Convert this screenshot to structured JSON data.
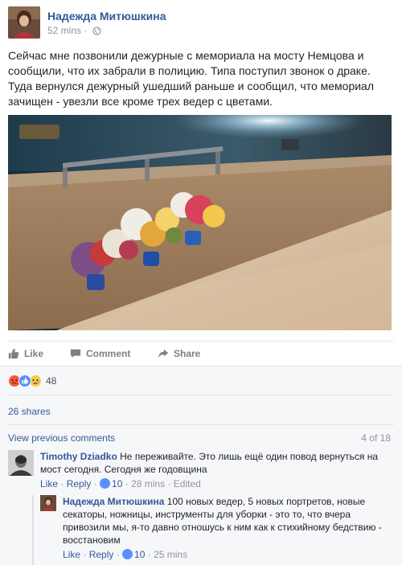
{
  "post": {
    "author": "Надежда Митюшкина",
    "time": "52 mins",
    "separator": "·",
    "privacy_icon": "globe-icon",
    "text": "Сейчас мне позвонили дежурные с мемориала на мосту Немцова и сообщили, что их забрали в полицию. Типа поступил звонок о драке. Туда вернулся дежурный ушедший раньше и сообщил, что мемориал зачищен - увезли все кроме трех ведер с цветами."
  },
  "actions": {
    "like": "Like",
    "comment": "Comment",
    "share": "Share"
  },
  "reactions": {
    "icons": [
      "angry-icon",
      "like-icon",
      "sad-icon"
    ],
    "count": "48"
  },
  "shares": "26 shares",
  "comments": {
    "view_previous": "View previous comments",
    "count_of": "4 of 18",
    "items": [
      {
        "author": "Timothy Dziadko",
        "text": "Не переживайте. Это лишь ещё один повод вернуться на мост сегодня. Сегодня же годовщина",
        "like": "Like",
        "reply": "Reply",
        "likes": "10",
        "time": "28 mins",
        "edited": "Edited"
      },
      {
        "author": "Надежда Митюшкина",
        "text": "100 новых ведер, 5 новых портретов, новые секаторы, ножницы, инструменты для уборки - это то, что вчера привозили мы, я-то давно отношусь к ним как к стихийному бедствию - восстановим",
        "like": "Like",
        "reply": "Reply",
        "likes": "10",
        "time": "25 mins"
      }
    ]
  },
  "colors": {
    "link": "#365899",
    "muted": "#90949c",
    "text": "#1d2129",
    "ufi_bg": "#f6f7f9"
  }
}
